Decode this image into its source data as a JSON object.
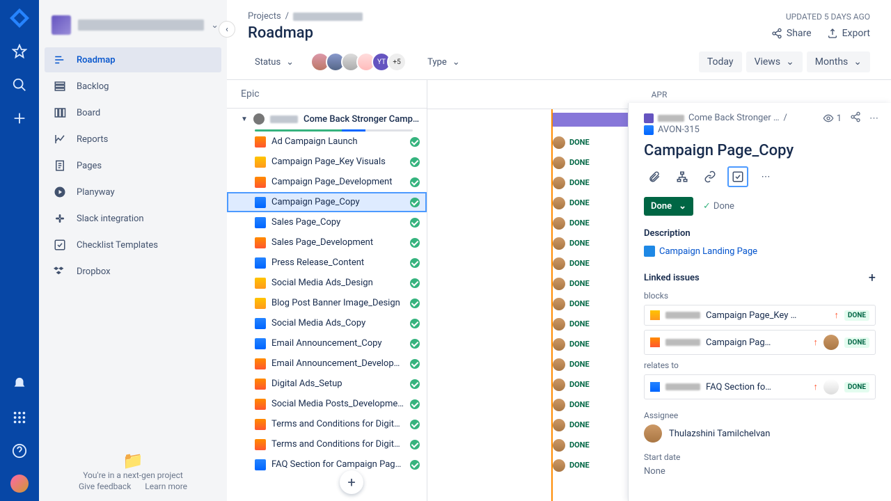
{
  "breadcrumb": {
    "projects": "Projects"
  },
  "updated_label": "UPDATED 5 DAYS AGO",
  "title": "Roadmap",
  "actions": {
    "share": "Share",
    "export": "Export"
  },
  "filters": {
    "status": "Status",
    "type": "Type",
    "extra_avatars": "+5"
  },
  "toolbar": {
    "today": "Today",
    "views": "Views",
    "months": "Months"
  },
  "columns": {
    "epic": "Epic",
    "month": "APR"
  },
  "epic_parent": "Come Back Stronger Campaign",
  "tasks": [
    {
      "label": "Ad Campaign Launch",
      "type": "ti-orange",
      "done_right": "DONE"
    },
    {
      "label": "Campaign Page_Key Visuals",
      "type": "ti-yellow",
      "done_right": "DONE"
    },
    {
      "label": "Campaign Page_Development",
      "type": "ti-orange",
      "done_right": "DONE"
    },
    {
      "label": "Campaign Page_Copy",
      "type": "ti-teal",
      "done_right": "DONE",
      "selected": true
    },
    {
      "label": "Sales Page_Copy",
      "type": "ti-teal",
      "done_right": "DONE"
    },
    {
      "label": "Sales Page_Development",
      "type": "ti-orange",
      "done_right": "DONE"
    },
    {
      "label": "Press Release_Content",
      "type": "ti-teal",
      "done_right": "DONE"
    },
    {
      "label": "Social Media Ads_Design",
      "type": "ti-yellow",
      "done_right": "DONE"
    },
    {
      "label": "Blog Post Banner Image_Design",
      "type": "ti-yellow",
      "done_right": "DONE"
    },
    {
      "label": "Social Media Ads_Copy",
      "type": "ti-teal",
      "done_right": "DONE"
    },
    {
      "label": "Email Announcement_Copy",
      "type": "ti-teal",
      "done_right": "DONE"
    },
    {
      "label": "Email Announcement_Developm…",
      "type": "ti-orange",
      "done_right": "DONE"
    },
    {
      "label": "Digital Ads_Setup",
      "type": "ti-orange",
      "done_right": "DONE"
    },
    {
      "label": "Social Media Posts_Development",
      "type": "ti-orange",
      "done_right": "DONE"
    },
    {
      "label": "Terms and Conditions for Digital …",
      "type": "ti-orange",
      "done_right": "DONE"
    },
    {
      "label": "Terms and Conditions for Digital …",
      "type": "ti-orange",
      "done_right": "DONE"
    },
    {
      "label": "FAQ Section for Campaign Page …",
      "type": "ti-teal",
      "done_right": "DONE"
    }
  ],
  "sidebar": {
    "items": [
      {
        "label": "Roadmap"
      },
      {
        "label": "Backlog"
      },
      {
        "label": "Board"
      },
      {
        "label": "Reports"
      },
      {
        "label": "Pages"
      },
      {
        "label": "Planyway"
      },
      {
        "label": "Slack integration"
      },
      {
        "label": "Checklist Templates"
      },
      {
        "label": "Dropbox"
      }
    ],
    "footer": {
      "msg": "You're in a next-gen project",
      "feedback": "Give feedback",
      "learn": "Learn more"
    }
  },
  "detail": {
    "crumb_parent": "Come Back Stronger …",
    "crumb_key": "AVON-315",
    "views": "1",
    "title": "Campaign Page_Copy",
    "status_button": "Done",
    "status_text": "Done",
    "h_desc": "Description",
    "doc_link": "Campaign Landing Page",
    "h_linked": "Linked issues",
    "blocks": "blocks",
    "relates": "relates to",
    "issue1": "Campaign Page_Key …",
    "issue2": "Campaign Pag…",
    "issue3": "FAQ Section fo…",
    "done_chip": "DONE",
    "h_assignee": "Assignee",
    "assignee": "Thulazshini Tamilchelvan",
    "h_start": "Start date",
    "start_val": "None"
  }
}
